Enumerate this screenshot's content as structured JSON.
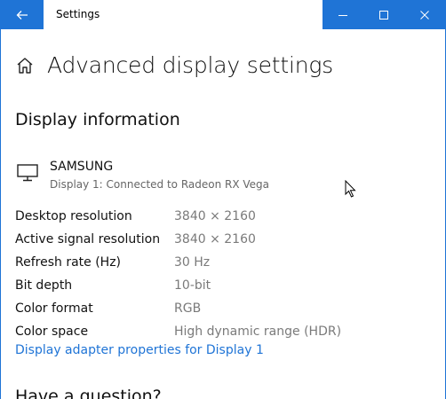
{
  "window": {
    "title": "Settings",
    "accent_color": "#1f74d6",
    "controls": [
      "minimize-icon",
      "maximize-icon",
      "close-icon"
    ]
  },
  "page": {
    "title": "Advanced display settings",
    "section_title": "Display information",
    "monitor": {
      "icon": "monitor-icon",
      "name": "SAMSUNG",
      "subtitle": "Display 1: Connected to Radeon RX Vega"
    },
    "properties": [
      {
        "label": "Desktop resolution",
        "value": "3840 × 2160"
      },
      {
        "label": "Active signal resolution",
        "value": "3840 × 2160"
      },
      {
        "label": "Refresh rate (Hz)",
        "value": "30 Hz"
      },
      {
        "label": "Bit depth",
        "value": "10-bit"
      },
      {
        "label": "Color format",
        "value": "RGB"
      },
      {
        "label": "Color space",
        "value": "High dynamic range (HDR)"
      }
    ],
    "adapter_link": "Display adapter properties for Display 1",
    "next_section_title": "Have a question?"
  }
}
